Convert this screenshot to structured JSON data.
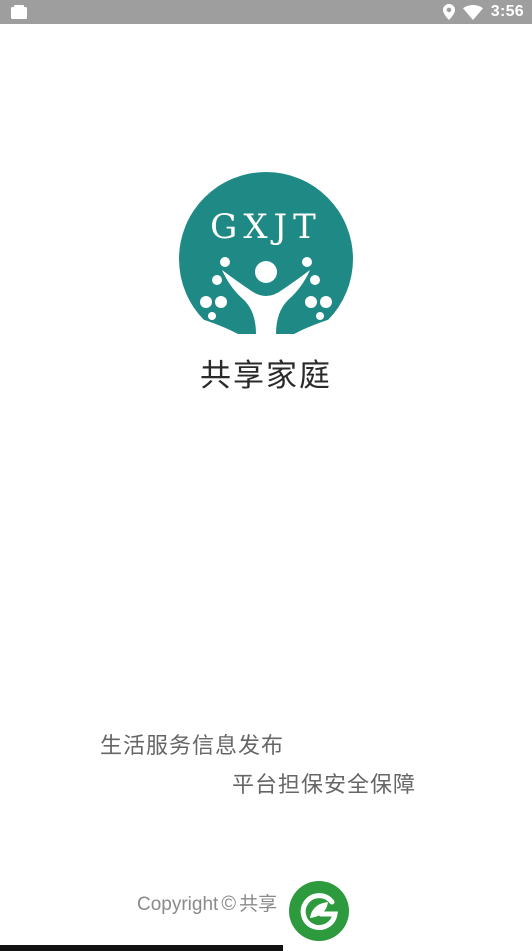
{
  "status_bar": {
    "time": "3:56",
    "icons": [
      "notification-icon",
      "location-icon",
      "wifi-icon"
    ]
  },
  "logo": {
    "text": "GXJT",
    "color": "#1f8a85"
  },
  "app_name": "共享家庭",
  "slogans": {
    "line1": "生活服务信息发布",
    "line2": "平台担保安全保障"
  },
  "footer": {
    "copyright_word": "Copyright",
    "copyright_symbol": "©",
    "owner_visible": "共享"
  },
  "watermark": {
    "icon": "leaf-g-logo",
    "color": "#2e9a3e"
  }
}
